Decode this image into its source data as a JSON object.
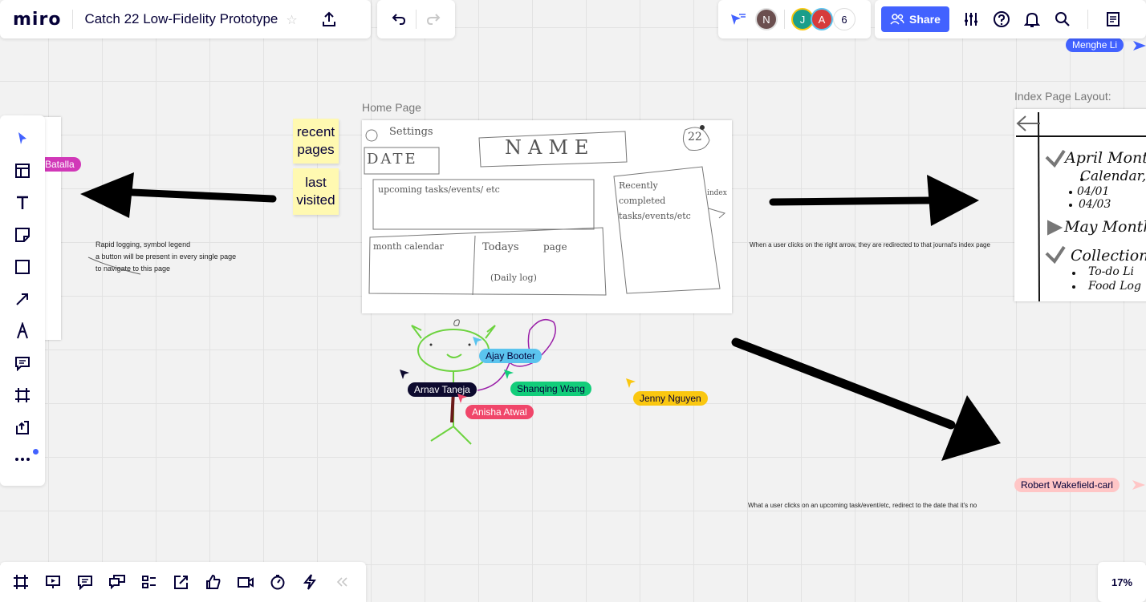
{
  "app": {
    "logo": "miro",
    "board_title": "Catch 22 Low-Fidelity Prototype"
  },
  "collaborators": {
    "avatars": [
      {
        "initial": "N",
        "color": "#6b4f4f"
      },
      {
        "initial": "J",
        "color": "#1a9e8a"
      },
      {
        "initial": "A",
        "color": "#d63b3b"
      }
    ],
    "count": "6"
  },
  "toolbar": {
    "share_label": "Share"
  },
  "zoom": {
    "level": "17%"
  },
  "canvas": {
    "home_frame_label": "Home Page",
    "index_frame_label": "Index Page Layout:",
    "sticky_recent": "recent pages",
    "sticky_last": "last visited",
    "note_rapid_1": "Rapid logging, symbol legend",
    "note_rapid_2": "a button will be present in every single page",
    "note_rapid_3": "to navigate to this page",
    "note_right_arrow": "When  a user clicks on the right arrow, they are redirected to that journal's index page",
    "note_upcoming": "What a user clicks on an upcoming task/event/etc, redirect to the date that it's no",
    "sketch": {
      "settings": "Settings",
      "name": "NAME",
      "date": "DATE",
      "upcoming": "upcoming tasks/events/ etc",
      "recently": "Recently completed tasks/events/etc",
      "index": "index",
      "month": "month calendar",
      "todays": "Todays",
      "page": "page",
      "daily": "(Daily log)",
      "badge": "22"
    },
    "index": {
      "april": "April Month",
      "calendar": "Calendar,",
      "d1": "04/01",
      "d2": "04/03",
      "may": "May Month",
      "collection": "Collection",
      "todo": "To-do Li",
      "food": "Food Log"
    }
  },
  "cursors": [
    {
      "name": "Menghe Li",
      "color": "#4262ff",
      "text": "#ffffff"
    },
    {
      "name": "Batalla",
      "color": "#d138b8",
      "text": "#ffffff"
    },
    {
      "name": "Ajay Booter",
      "color": "#5bc4ee",
      "text": "#050038"
    },
    {
      "name": "Arnav Taneja",
      "color": "#0d0a2e",
      "text": "#ffffff"
    },
    {
      "name": "Shanqing Wang",
      "color": "#12cd7a",
      "text": "#050038"
    },
    {
      "name": "Anisha Atwal",
      "color": "#f0466a",
      "text": "#ffffff"
    },
    {
      "name": "Jenny Nguyen",
      "color": "#fac710",
      "text": "#050038"
    },
    {
      "name": "Robert Wakefield-carl",
      "color": "#ffc6c6",
      "text": "#050038"
    }
  ]
}
